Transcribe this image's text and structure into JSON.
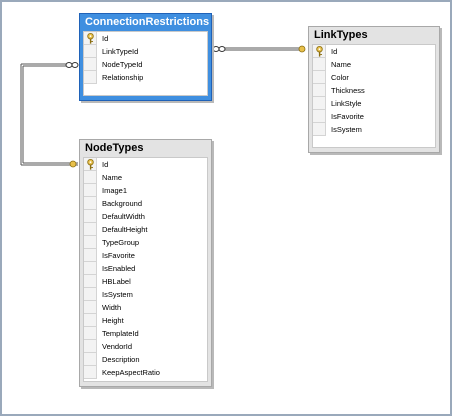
{
  "tables": {
    "connection_restrictions": {
      "title": "ConnectionRestrictions",
      "columns": [
        "Id",
        "LinkTypeId",
        "NodeTypeId",
        "Relationship"
      ]
    },
    "link_types": {
      "title": "LinkTypes",
      "columns": [
        "Id",
        "Name",
        "Color",
        "Thickness",
        "LinkStyle",
        "IsFavorite",
        "IsSystem"
      ]
    },
    "node_types": {
      "title": "NodeTypes",
      "columns": [
        "Id",
        "Name",
        "Image1",
        "Background",
        "DefaultWidth",
        "DefaultHeight",
        "TypeGroup",
        "IsFavorite",
        "IsEnabled",
        "HBLabel",
        "IsSystem",
        "Width",
        "Height",
        "TemplateId",
        "VendorId",
        "Description",
        "KeepAspectRatio"
      ]
    }
  },
  "colors": {
    "selected_header": "#3f8fe0",
    "table_header": "#e3e3e3",
    "key_icon": "#e8c04a",
    "relationship_line": "#555555"
  }
}
